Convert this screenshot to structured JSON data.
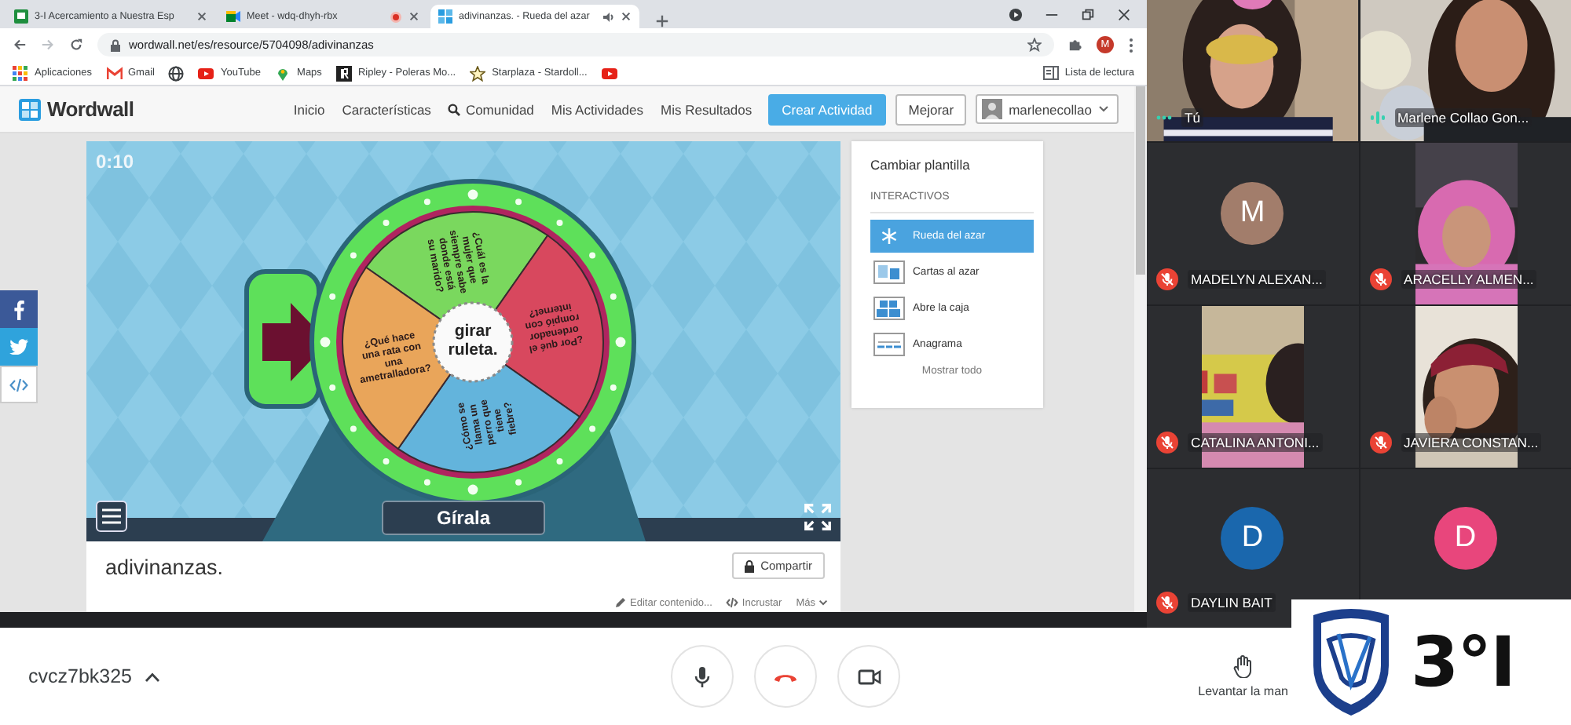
{
  "browser": {
    "tabs": [
      {
        "title": "3-I Acercamiento a Nuestra Esp",
        "kind": "classroom",
        "selected": false
      },
      {
        "title": "Meet - wdq-dhyh-rbx",
        "kind": "meet",
        "selected": false
      },
      {
        "title": "adivinanzas. - Rueda del azar",
        "kind": "wordwall",
        "selected": true
      }
    ],
    "url": "wordwall.net/es/resource/5704098/adivinanzas",
    "profile_initial": "M",
    "bookmarks": [
      {
        "label": "Aplicaciones",
        "kind": "apps"
      },
      {
        "label": "Gmail",
        "kind": "mail"
      },
      {
        "kind": "globe"
      },
      {
        "label": "YouTube",
        "kind": "video"
      },
      {
        "label": "Maps",
        "kind": "pin"
      },
      {
        "label": "Ripley - Poleras Mo...",
        "kind": "square"
      },
      {
        "label": "Starplaza - Stardoll...",
        "kind": "star"
      },
      {
        "kind": "video"
      }
    ],
    "reading_list": "Lista de lectura"
  },
  "wordwall": {
    "logo": "Wordwall",
    "nav": [
      {
        "label": "Inicio",
        "kind": "link"
      },
      {
        "label": "Características",
        "kind": "link"
      },
      {
        "label": "Comunidad",
        "kind": "search"
      },
      {
        "label": "Mis Actividades",
        "kind": "link"
      },
      {
        "label": "Mis Resultados",
        "kind": "link"
      }
    ],
    "create_button": "Crear Actividad",
    "upgrade_button": "Mejorar",
    "user": "marlenecollao"
  },
  "game": {
    "timer": "0:10",
    "center": "girar ruleta.",
    "spin_button": "Gírala",
    "segments": [
      {
        "text": "¿Cuál es la mujer que siempre sabe donde está su marido?",
        "color": "#7ad85e"
      },
      {
        "text": "¿Por qué el ordenador rompió con internet?",
        "color": "#d8485e"
      },
      {
        "text": "¿Cómo se llama un perro que tiene fiebre?",
        "color": "#63b4dc"
      },
      {
        "text": "¿Qué hace una rata con una ametralladora?",
        "color": "#e9a55a"
      }
    ]
  },
  "activity": {
    "title": "adivinanzas.",
    "share_button": "Compartir",
    "actions": [
      {
        "label": "Editar contenido...",
        "kind": "edit"
      },
      {
        "label": "Incrustar",
        "kind": "embed"
      },
      {
        "label": "Más",
        "kind": "more"
      }
    ]
  },
  "templates": {
    "heading": "Cambiar plantilla",
    "section": "INTERACTIVOS",
    "items": [
      {
        "label": "Rueda del azar",
        "kind": "wheel",
        "selected": true
      },
      {
        "label": "Cartas al azar",
        "kind": "cards",
        "selected": false
      },
      {
        "label": "Abre la caja",
        "kind": "box",
        "selected": false
      },
      {
        "label": "Anagrama",
        "kind": "anagram",
        "selected": false
      }
    ],
    "show_all": "Mostrar todo"
  },
  "participants": [
    {
      "name": "Tú",
      "kind": "video",
      "muted": false,
      "speaking": false
    },
    {
      "name": "Marlene Collao Gon...",
      "kind": "video",
      "muted": false,
      "speaking": true
    },
    {
      "name": "MADELYN ALEXAN...",
      "kind": "avatar",
      "initial": "M",
      "color": "#a27d6b",
      "muted": true
    },
    {
      "name": "ARACELLY ALMEN...",
      "kind": "portrait",
      "muted": true
    },
    {
      "name": "CATALINA ANTONI...",
      "kind": "portrait",
      "muted": true
    },
    {
      "name": "JAVIERA CONSTAN...",
      "kind": "portrait",
      "muted": true
    },
    {
      "name": "DAYLIN BAIT",
      "kind": "avatar",
      "initial": "D",
      "color": "#1a67ad",
      "muted": true
    },
    {
      "kind": "avatar",
      "initial": "D",
      "color": "#e8467c"
    }
  ],
  "meeting": {
    "code": "cvcz7bk325",
    "raise_hand": "Levantar la man"
  },
  "badge": {
    "label": "3°I"
  }
}
